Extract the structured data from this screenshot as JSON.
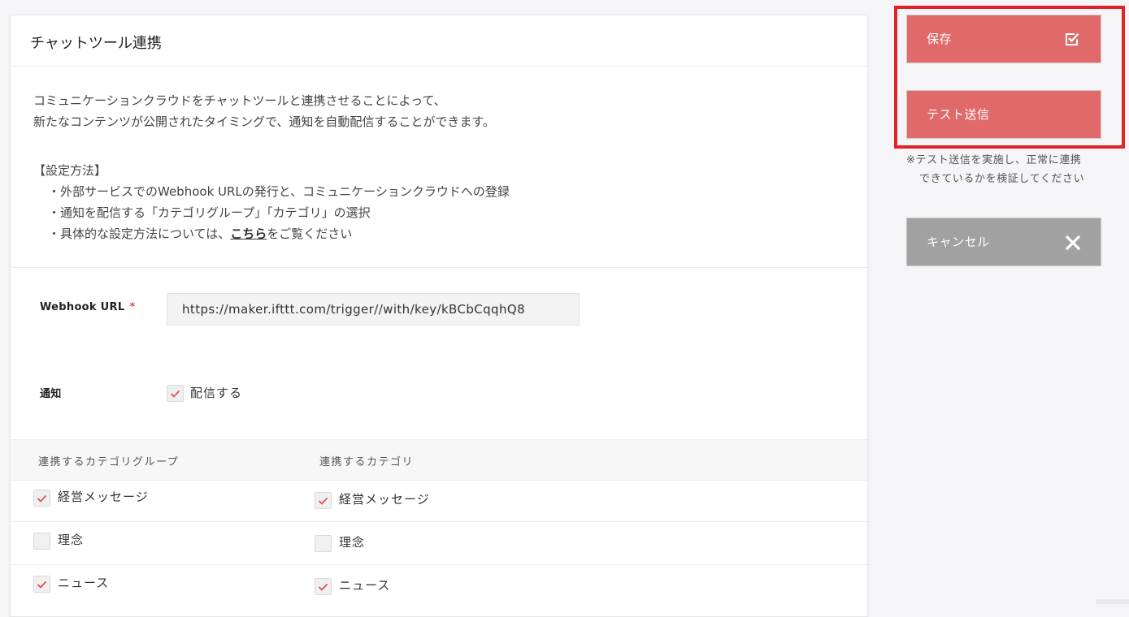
{
  "card": {
    "title": "チャットツール連携",
    "description": [
      "コミュニケーションクラウドをチャットツールと連携させることによって、",
      "新たなコンテンツが公開されたタイミングで、通知を自動配信することができます。"
    ],
    "howto": {
      "heading": "【設定方法】",
      "item1": "・外部サービスでのWebhook URLの発行と、コミュニケーションクラウドへの登録",
      "item2": "・通知を配信する「カテゴリグループ」「カテゴリ」の選択",
      "item3_prefix": "・具体的な設定方法については、",
      "item3_link": "こちら",
      "item3_suffix": "をご覧ください"
    }
  },
  "webhook": {
    "label": "Webhook URL",
    "required_mark": "*",
    "value": "https://maker.ifttt.com/trigger//with/key/kBCbCqqhQ8"
  },
  "notify": {
    "label": "通知",
    "checkbox_label": "配信する",
    "checked": true
  },
  "table": {
    "col_group": "連携するカテゴリグループ",
    "col_category": "連携するカテゴリ",
    "rows": [
      {
        "group": "経営メッセージ",
        "group_checked": true,
        "category": "経営メッセージ",
        "category_checked": true
      },
      {
        "group": "理念",
        "group_checked": false,
        "category": "理念",
        "category_checked": false
      },
      {
        "group": "ニュース",
        "group_checked": true,
        "category": "ニュース",
        "category_checked": true
      }
    ]
  },
  "sidebar": {
    "save_label": "保存",
    "test_label": "テスト送信",
    "note_line1": "※テスト送信を実施し、正常に連携",
    "note_line2": "できているかを検証してください",
    "cancel_label": "キャンセル"
  },
  "colors": {
    "accent": "#e06a6a",
    "cancel": "#a1a1a1",
    "highlight": "#e0222a",
    "check": "#e05050"
  }
}
